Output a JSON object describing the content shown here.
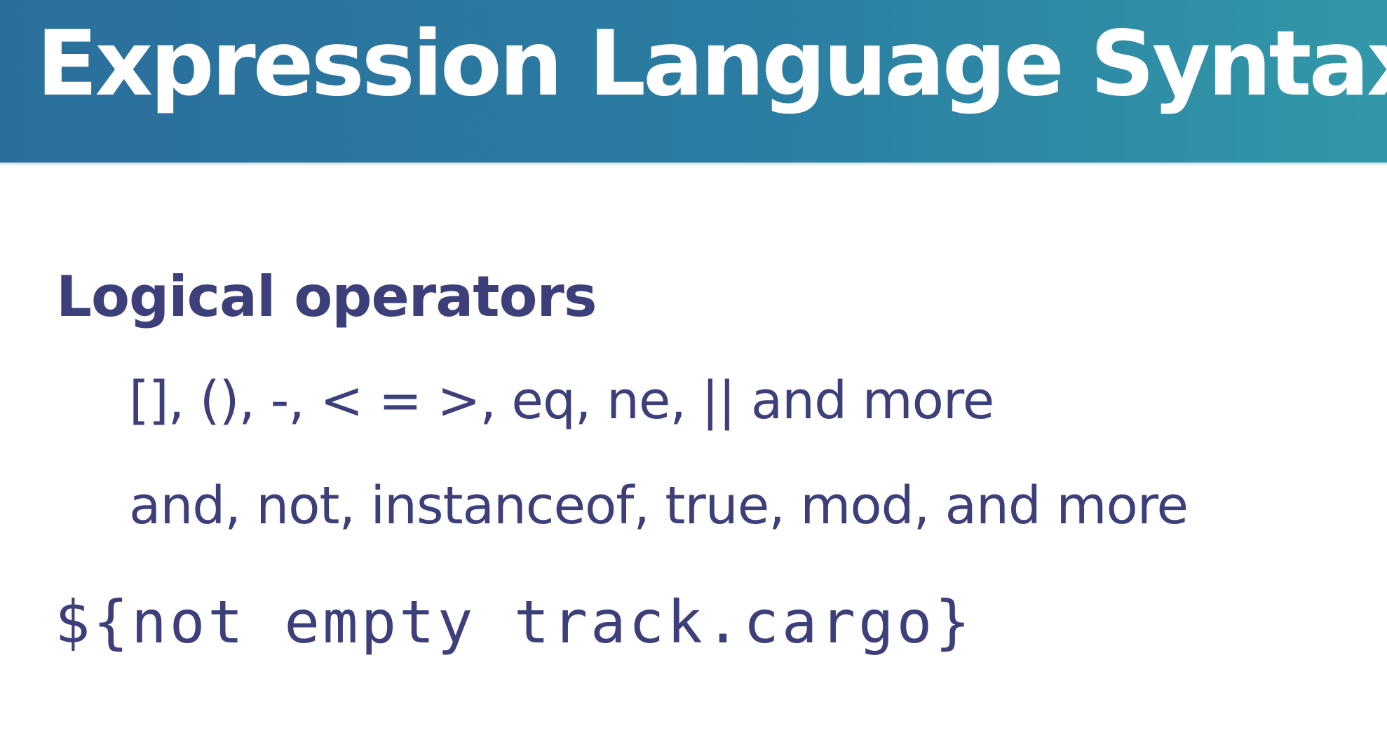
{
  "slide": {
    "title": "Expression Language Syntax",
    "section_heading": "Logical operators",
    "bullets": [
      "[], (), -, < = >, eq, ne, || and more",
      "and, not, instanceof, true, mod, and more"
    ],
    "code_example": "${not empty track.cargo}"
  },
  "colors": {
    "header_gradient_start": "#2a6f9c",
    "header_gradient_end": "#3298a8",
    "title_text": "#ffffff",
    "body_text": "#3d3f7a",
    "background": "#ffffff"
  }
}
